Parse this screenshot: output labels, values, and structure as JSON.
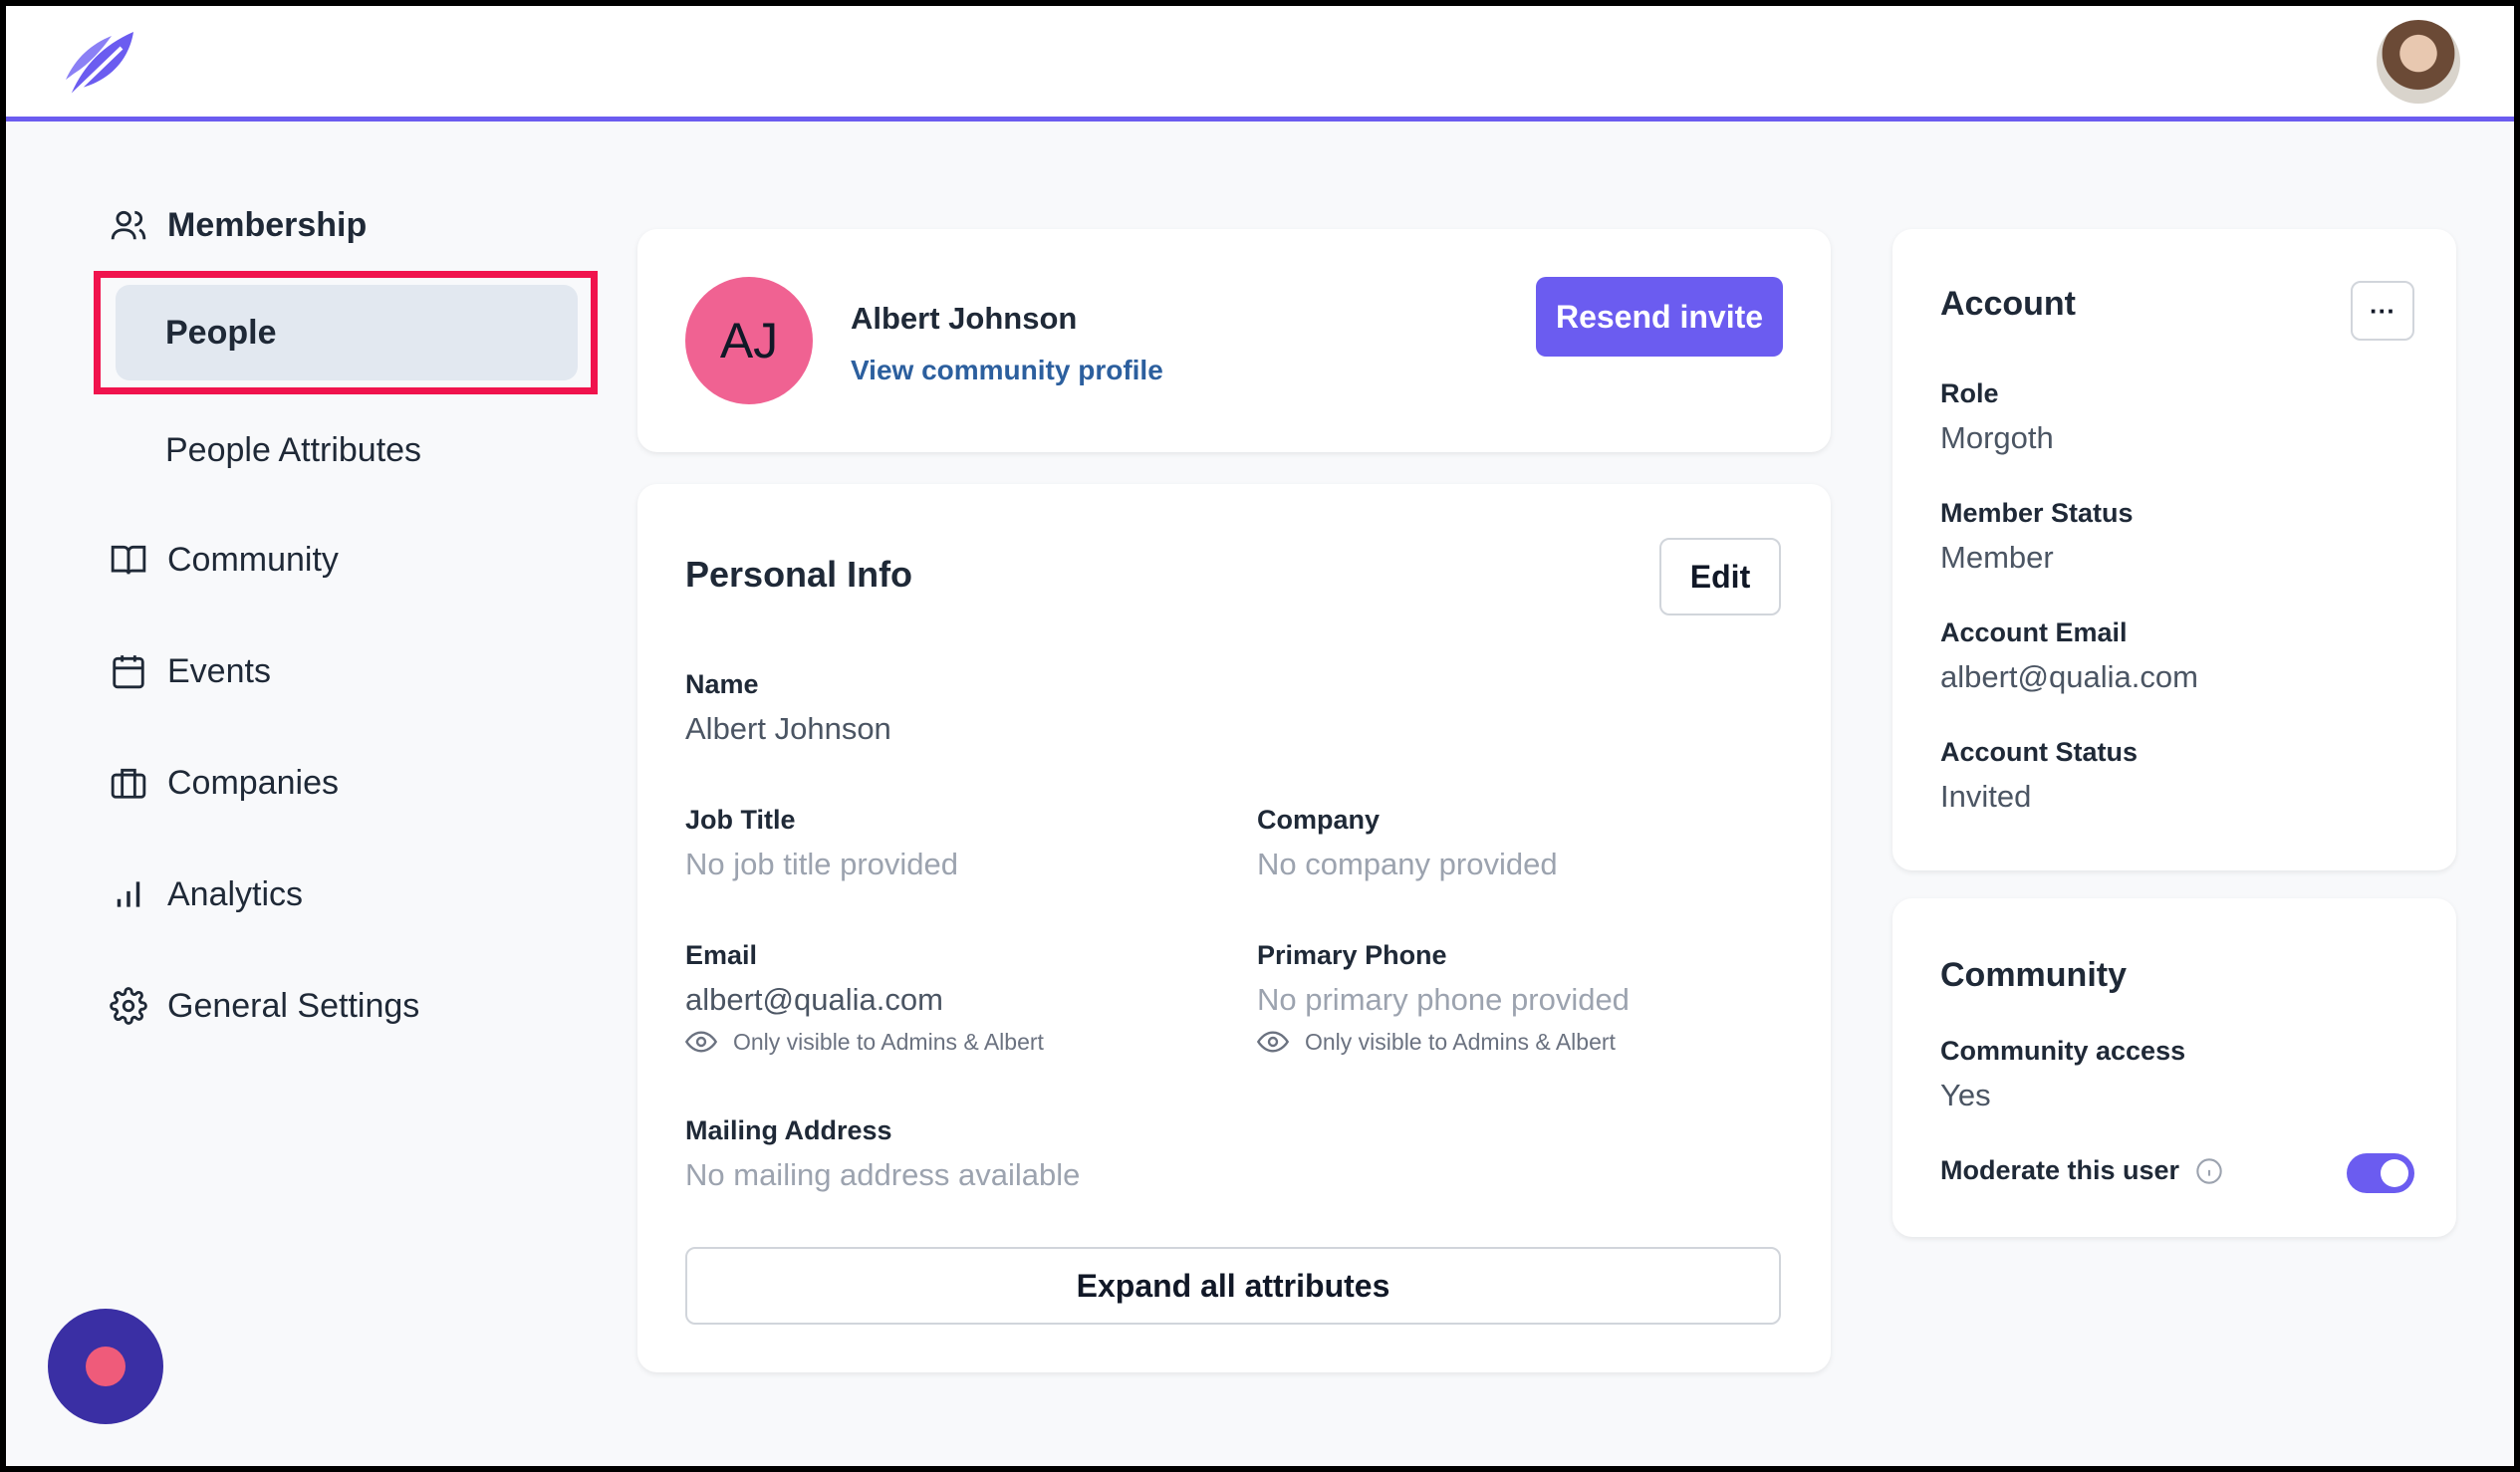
{
  "nav": {
    "membership": "Membership",
    "people": "People",
    "people_attributes": "People Attributes",
    "community": "Community",
    "events": "Events",
    "companies": "Companies",
    "analytics": "Analytics",
    "general_settings": "General Settings"
  },
  "profile": {
    "initials": "AJ",
    "name": "Albert Johnson",
    "view_profile_link": "View community profile",
    "resend_button": "Resend invite"
  },
  "personal_info": {
    "title": "Personal Info",
    "edit_button": "Edit",
    "name_label": "Name",
    "name_value": "Albert Johnson",
    "job_title_label": "Job Title",
    "job_title_value": "No job title provided",
    "company_label": "Company",
    "company_value": "No company provided",
    "email_label": "Email",
    "email_value": "albert@qualia.com",
    "email_visibility": "Only visible to Admins & Albert",
    "phone_label": "Primary Phone",
    "phone_value": "No primary phone provided",
    "phone_visibility": "Only visible to Admins & Albert",
    "mailing_label": "Mailing Address",
    "mailing_value": "No mailing address available",
    "expand_button": "Expand all attributes"
  },
  "account": {
    "title": "Account",
    "more_button": "···",
    "role_label": "Role",
    "role_value": "Morgoth",
    "member_status_label": "Member Status",
    "member_status_value": "Member",
    "account_email_label": "Account Email",
    "account_email_value": "albert@qualia.com",
    "account_status_label": "Account Status",
    "account_status_value": "Invited"
  },
  "community": {
    "title": "Community",
    "access_label": "Community access",
    "access_value": "Yes",
    "moderate_label": "Moderate this user",
    "moderate_on": true
  },
  "colors": {
    "accent": "#6b5cf0",
    "highlight": "#f0134d",
    "avatar_bg": "#f06292",
    "link": "#2c5f9e"
  }
}
